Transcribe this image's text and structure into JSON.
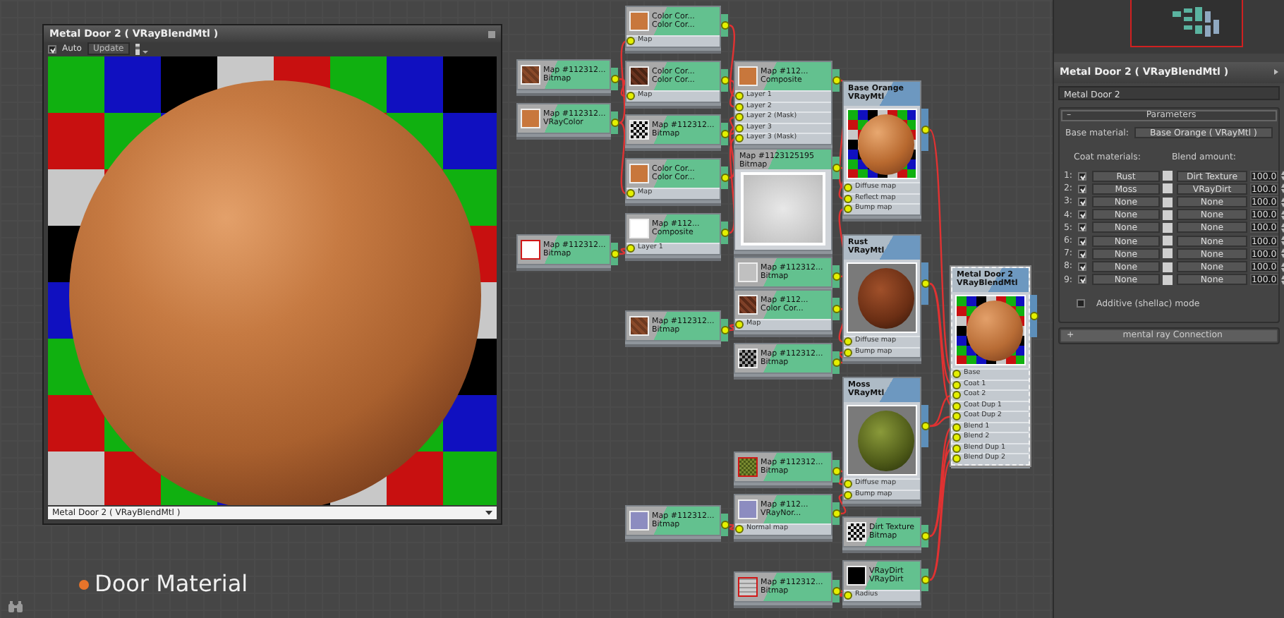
{
  "preview_window": {
    "title": "Metal Door 2  ( VRayBlendMtl )",
    "auto": {
      "label": "Auto",
      "checked": true
    },
    "update_button": "Update",
    "material_dropdown": "Metal Door 2  ( VRayBlendMtl )"
  },
  "caption": "Door Material",
  "nodes": [
    {
      "title": "Color Cor...",
      "type": "Color Cor...",
      "kind": "map",
      "selected": false,
      "slots": [
        "Map"
      ]
    },
    {
      "title": "Map #112312...",
      "type": "Bitmap",
      "kind": "map",
      "selected": false
    },
    {
      "title": "Map #112312...",
      "type": "VRayColor",
      "kind": "map",
      "selected": false
    },
    {
      "title": "Color Cor...",
      "type": "Color Cor...",
      "kind": "map",
      "selected": false,
      "slots": [
        "Map"
      ]
    },
    {
      "title": "Map #112312...",
      "type": "Bitmap",
      "kind": "map",
      "selected": false
    },
    {
      "title": "Color Cor...",
      "type": "Color Cor...",
      "kind": "map",
      "selected": false,
      "slots": [
        "Map"
      ]
    },
    {
      "title": "Map #112...",
      "type": "Composite",
      "kind": "map",
      "selected": false,
      "slots": [
        "Layer 1"
      ]
    },
    {
      "title": "Map #112312...",
      "type": "Bitmap",
      "kind": "map",
      "selected": false
    },
    {
      "title": "Map #112...",
      "type": "Composite",
      "kind": "map",
      "selected": false,
      "slots": [
        "Layer 1",
        "Layer 2",
        "Layer 2 (Mask)",
        "Layer 3",
        "Layer 3 (Mask)"
      ]
    },
    {
      "title": "Map #1123125195",
      "type": "Bitmap",
      "kind": "map",
      "selected": false
    },
    {
      "title": "Map #112312...",
      "type": "Bitmap",
      "kind": "map",
      "selected": false
    },
    {
      "title": "Map #112...",
      "type": "Color Cor...",
      "kind": "map",
      "selected": false,
      "slots": [
        "Map"
      ]
    },
    {
      "title": "Map #112312...",
      "type": "Bitmap",
      "kind": "map",
      "selected": false
    },
    {
      "title": "Map #112312...",
      "type": "Bitmap",
      "kind": "map",
      "selected": false
    },
    {
      "title": "Map #112312...",
      "type": "Bitmap",
      "kind": "map",
      "selected": false
    },
    {
      "title": "Map #112312...",
      "type": "Bitmap",
      "kind": "map",
      "selected": false
    },
    {
      "title": "Map #112...",
      "type": "VRayNor...",
      "kind": "map",
      "selected": false,
      "slots": [
        "Normal map"
      ]
    },
    {
      "title": "Map #112312...",
      "type": "Bitmap",
      "kind": "map",
      "selected": false
    },
    {
      "title": "Base Orange",
      "type": "VRayMtl",
      "kind": "material",
      "selected": false,
      "slots": [
        "Diffuse map",
        "Reflect map",
        "Bump map"
      ]
    },
    {
      "title": "Rust",
      "type": "VRayMtl",
      "kind": "material",
      "selected": false,
      "slots": [
        "Diffuse map",
        "Bump map"
      ]
    },
    {
      "title": "Moss",
      "type": "VRayMtl",
      "kind": "material",
      "selected": false,
      "slots": [
        "Diffuse map",
        "Bump map"
      ]
    },
    {
      "title": "Dirt Texture",
      "type": "Bitmap",
      "kind": "map",
      "selected": false
    },
    {
      "title": "VRayDirt",
      "type": "VRayDirt",
      "kind": "map",
      "selected": false,
      "slots": [
        "Radius"
      ]
    },
    {
      "title": "Metal Door 2",
      "type": "VRayBlendMtl",
      "kind": "material",
      "selected": true,
      "slots": [
        "Base",
        "Coat 1",
        "Coat 2",
        "Coat Dup 1",
        "Coat Dup 2",
        "Blend 1",
        "Blend 2",
        "Blend Dup 1",
        "Blend Dup 2"
      ]
    }
  ],
  "panel": {
    "title": "Metal Door 2  ( VRayBlendMtl )",
    "name_field": "Metal Door 2",
    "rollouts": [
      {
        "symbol": "–",
        "title": "Parameters",
        "expanded": true
      },
      {
        "symbol": "+",
        "title": "mental ray Connection",
        "expanded": false
      }
    ],
    "base_material_label": "Base material:",
    "base_material": "Base Orange  ( VRayMtl )",
    "coat_header": "Coat materials:",
    "blend_header": "Blend amount:",
    "coats": [
      {
        "index": "1:",
        "enabled": true,
        "material": "Rust",
        "map": "Dirt Texture",
        "amount": "100.0"
      },
      {
        "index": "2:",
        "enabled": true,
        "material": "Moss",
        "map": "VRayDirt",
        "amount": "100.0"
      },
      {
        "index": "3:",
        "enabled": true,
        "material": "None",
        "map": "None",
        "amount": "100.0"
      },
      {
        "index": "4:",
        "enabled": true,
        "material": "None",
        "map": "None",
        "amount": "100.0"
      },
      {
        "index": "5:",
        "enabled": true,
        "material": "None",
        "map": "None",
        "amount": "100.0"
      },
      {
        "index": "6:",
        "enabled": true,
        "material": "None",
        "map": "None",
        "amount": "100.0"
      },
      {
        "index": "7:",
        "enabled": true,
        "material": "None",
        "map": "None",
        "amount": "100.0"
      },
      {
        "index": "8:",
        "enabled": true,
        "material": "None",
        "map": "None",
        "amount": "100.0"
      },
      {
        "index": "9:",
        "enabled": true,
        "material": "None",
        "map": "None",
        "amount": "100.0"
      }
    ],
    "additive": {
      "label": "Additive (shellac) mode",
      "checked": false
    }
  }
}
